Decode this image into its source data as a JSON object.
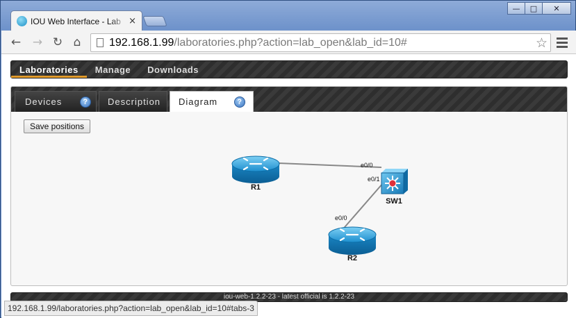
{
  "browser": {
    "tab_title": "IOU Web Interface - Lab",
    "url_host": "192.168.1.99",
    "url_rest": "/laboratories.php?action=lab_open&lab_id=10#",
    "status_url": "192.168.1.99/laboratories.php?action=lab_open&lab_id=10#tabs-3"
  },
  "nav": {
    "items": [
      "Laboratories",
      "Manage",
      "Downloads"
    ],
    "active": "Laboratories"
  },
  "panel": {
    "tabs": [
      "Devices",
      "Description",
      "Diagram"
    ],
    "active_tab": "Diagram",
    "help_glyph": "?",
    "save_label": "Save positions"
  },
  "diagram": {
    "nodes": [
      {
        "name": "R1",
        "kind": "router-icon"
      },
      {
        "name": "SW1",
        "kind": "switch-icon"
      },
      {
        "name": "R2",
        "kind": "router-icon"
      }
    ],
    "links": [
      {
        "from": "R1",
        "to": "SW1",
        "to_port": "e0/0"
      },
      {
        "from": "SW1",
        "to": "R2",
        "from_port": "e0/1",
        "to_port": "e0/0"
      }
    ]
  },
  "footer": {
    "text": "iou-web-1.2.2-23 - latest official is 1.2.2-23"
  },
  "colors": {
    "accent_underline": "#e19a2a",
    "router_blue": "#1d8fcf",
    "switch_blue": "#2a9ad6",
    "switch_center": "#e0303a"
  }
}
